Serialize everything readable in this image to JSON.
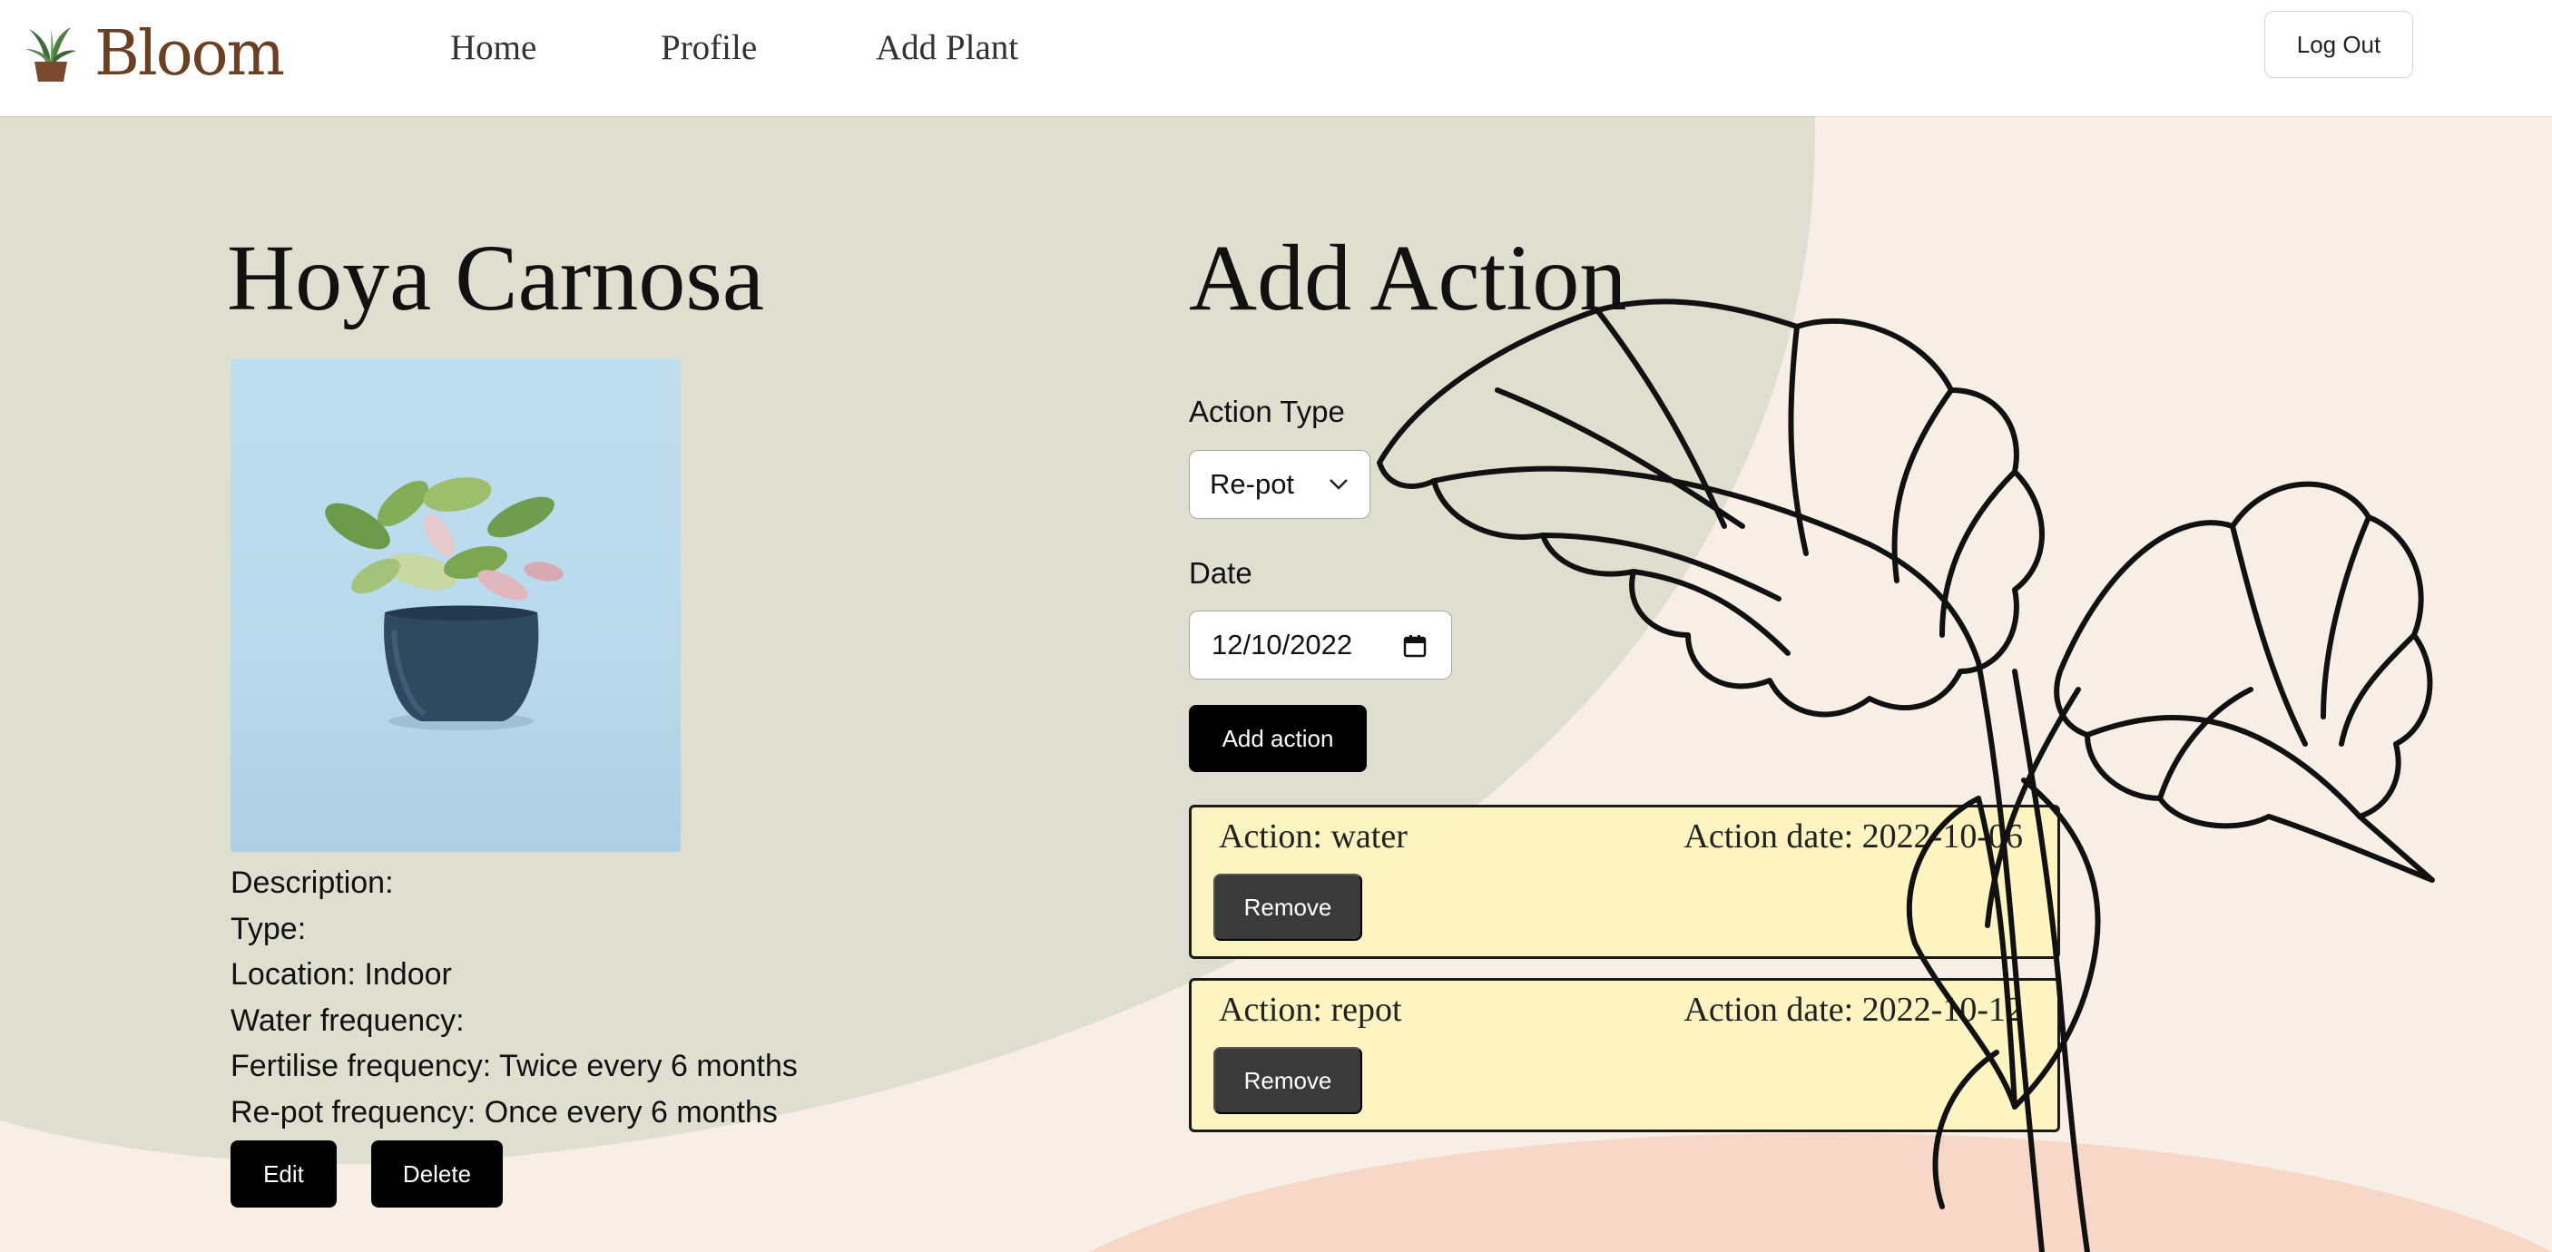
{
  "colors": {
    "sage_blob": "#dfdfd0",
    "cream_background": "#f7efe6",
    "peach_blob": "#f6d7c8",
    "brand_brown": "#6b3f22",
    "action_card": "#fdf4be",
    "primary_button": "#000000",
    "remove_button": "#3a3a3a"
  },
  "nav": {
    "brand": "Bloom",
    "logo_icon": "potted-plant-icon",
    "links": [
      "Home",
      "Profile",
      "Add Plant"
    ],
    "logout_label": "Log Out"
  },
  "plant": {
    "name": "Hoya Carnosa",
    "details": [
      "Description:",
      "Type:",
      "Location: Indoor",
      "Water frequency:",
      "Fertilise frequency: Twice every 6 months",
      "Re-pot frequency: Once every 6 months"
    ],
    "edit_label": "Edit",
    "delete_label": "Delete"
  },
  "add_action": {
    "title": "Add Action",
    "action_type_label": "Action Type",
    "action_type_value": "Re-pot",
    "date_label": "Date",
    "date_value": "12/10/2022",
    "submit_label": "Add action"
  },
  "actions": [
    {
      "name": "Action: water",
      "date": "Action date: 2022-10-06",
      "remove_label": "Remove"
    },
    {
      "name": "Action: repot",
      "date": "Action date:  2022-10-12",
      "remove_label": "Remove"
    }
  ]
}
